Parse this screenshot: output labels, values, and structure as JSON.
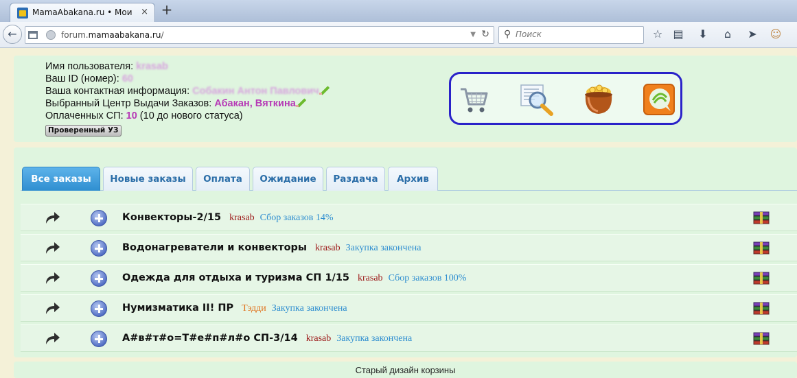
{
  "browser": {
    "tab_title": "MamaAbakana.ru • Мои за...",
    "tab_close": "×",
    "new_tab": "+",
    "url_domain_prefix": "forum.",
    "url_domain": "mamaabakana.ru",
    "url_path": "/",
    "search_placeholder": "Поиск"
  },
  "user_info": {
    "username_label": "Имя пользователя:",
    "username_value": "krasab",
    "id_label": "Ваш ID (номер):",
    "id_value": "60",
    "contact_label": "Ваша контактная информация:",
    "contact_value": "Собакин Антон Павлович",
    "pickup_label": "Выбранный Центр Выдачи Заказов:",
    "pickup_value": "Абакан, Вяткина",
    "paid_label": "Оплаченных СП:",
    "paid_count": "10",
    "paid_note": "(10 до нового статуса)",
    "verified_button": "Проверенный УЗ"
  },
  "icons": [
    "cart-icon",
    "magnify-icon",
    "coin-pot-icon",
    "chat-icon",
    "arrow-icon",
    "plus-icon",
    "archive-icon"
  ],
  "tabs": [
    {
      "label": "Все заказы",
      "active": true
    },
    {
      "label": "Новые заказы",
      "active": false
    },
    {
      "label": "Оплата",
      "active": false
    },
    {
      "label": "Ожидание",
      "active": false
    },
    {
      "label": "Раздача",
      "active": false
    },
    {
      "label": "Архив",
      "active": false
    }
  ],
  "orders": [
    {
      "title": "Конвекторы-2/15",
      "user": "krasab",
      "status": "Сбор заказов 14%"
    },
    {
      "title": "Водонагреватели и конвекторы",
      "user": "krasab",
      "status": "Закупка закончена"
    },
    {
      "title": "Одежда для отдыха и туризма СП 1/15",
      "user": "krasab",
      "status": "Сбор заказов 100%"
    },
    {
      "title": "Нумизматика II! ПР",
      "user": "Тэдди",
      "status": "Закупка закончена"
    },
    {
      "title": "А#в#т#о=Т#е#п#л#о СП-3/14",
      "user": "krasab",
      "status": "Закупка закончена"
    }
  ],
  "footer": {
    "old_design_link": "Старый дизайн корзины"
  },
  "colors": {
    "panel_bg": "#dff5df",
    "active_tab": "#2f8ed0",
    "username_highlight": "#b63ab6",
    "status_link": "#2f8ed0",
    "user_red": "#9b1616",
    "user_orange": "#e0721c",
    "icon_box_border": "#2a22c9"
  }
}
